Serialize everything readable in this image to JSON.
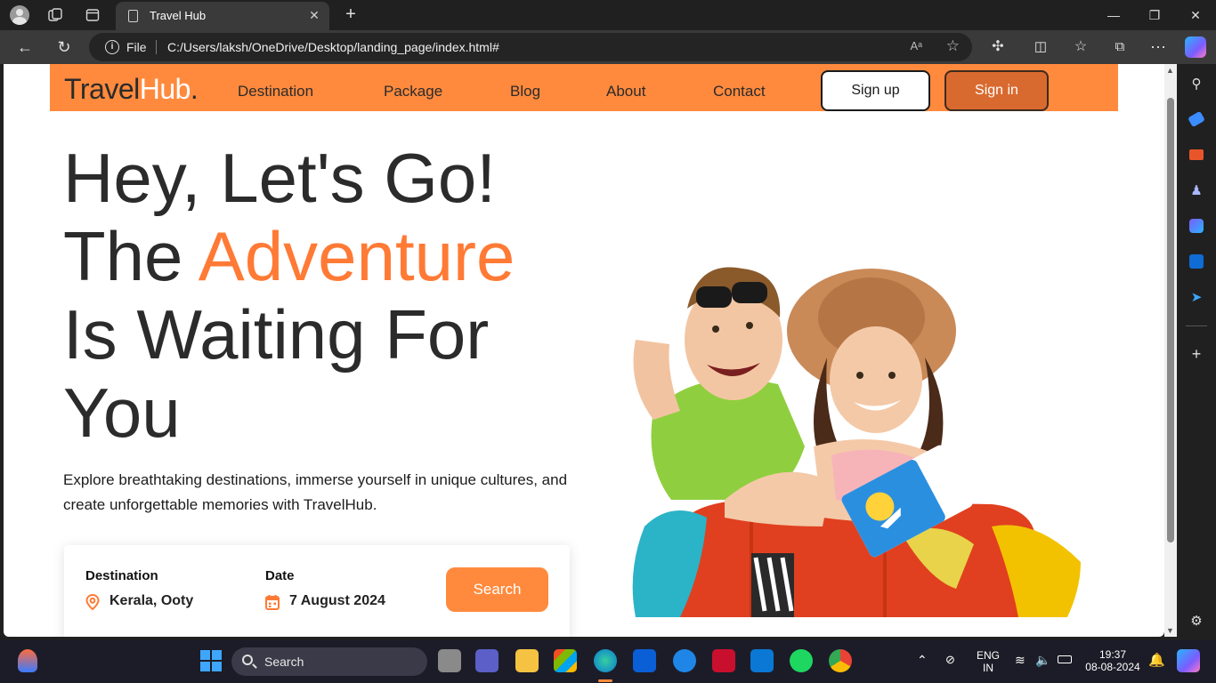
{
  "browser": {
    "tab_title": "Travel Hub",
    "address_scheme": "File",
    "address_url": "C:/Users/laksh/OneDrive/Desktop/landing_page/index.html#",
    "read_aloud": "Aᵃ"
  },
  "site": {
    "logo_travel": "Travel",
    "logo_hub": "Hub",
    "logo_dot": ".",
    "nav_links": [
      "Destination",
      "Package",
      "Blog",
      "About",
      "Contact"
    ],
    "signup_label": "Sign up",
    "signin_label": "Sign in",
    "brand_color": "#ff8a3d"
  },
  "hero": {
    "line1": "Hey, Let's Go!",
    "line2_pre": "The ",
    "line2_accent": "Adventure",
    "line3": "Is Waiting For",
    "line4": "You",
    "description": "Explore breathtaking destinations, immerse yourself in unique cultures, and create unforgettable memories with TravelHub.",
    "accent_color": "#ff7a35"
  },
  "search_card": {
    "destination_label": "Destination",
    "destination_value": "Kerala, Ooty",
    "date_label": "Date",
    "date_value": "7 August 2024",
    "search_label": "Search"
  },
  "taskbar": {
    "search_label": "Search",
    "lang_1": "ENG",
    "lang_2": "IN",
    "time": "19:37",
    "date": "08-08-2024"
  }
}
